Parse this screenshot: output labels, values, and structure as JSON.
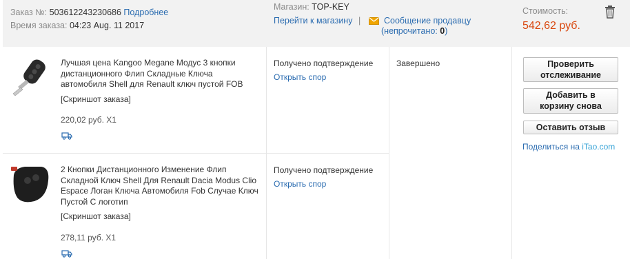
{
  "order": {
    "number_label": "Заказ №:",
    "number": "503612243230686",
    "details_link": "Подробнее",
    "time_label": "Время заказа:",
    "time": "04:23 Aug. 11 2017",
    "store_label": "Магазин:",
    "store_name": "TOP-KEY",
    "go_to_store": "Перейти к магазину",
    "separator": "|",
    "message_link": "Сообщение продавцу",
    "unread_prefix": "(непрочитано: ",
    "unread_count": "0",
    "unread_suffix": ")",
    "cost_label": "Стоимость:",
    "cost_value": "542,62 руб."
  },
  "items": [
    {
      "title": "Лучшая цена Kangoo Megane Модус 3 кнопки дистанционного Флип Складные Ключа автомобиля Shell для Renault ключ пустой FOB",
      "screenshot_label": "[Скриншот заказа]",
      "price_qty": "220,02 руб. X1",
      "status": "Получено подтверждение",
      "dispute_link": "Открыть спор"
    },
    {
      "title": "2 Кнопки Дистанционного Изменение Флип Складной Ключ Shell Для Renault Dacia Modus Clio Espace Логан Ключа Автомобиля Fob Случае Ключ Пустой С логотип",
      "screenshot_label": "[Скриншот заказа]",
      "price_qty": "278,11 руб. X1",
      "status": "Получено подтверждение",
      "dispute_link": "Открыть спор"
    }
  ],
  "order_status": "Завершено",
  "actions": {
    "track_line1": "Проверить",
    "track_line2": "отслеживание",
    "add_cart_line1": "Добавить в",
    "add_cart_line2": "корзину снова",
    "review": "Оставить отзыв",
    "share_prefix": "Поделиться на ",
    "share_site": "iTao.com"
  },
  "icons": {
    "trash": "trash-icon",
    "envelope": "envelope-icon",
    "truck": "delivery-truck-icon"
  },
  "colors": {
    "link": "#2b6cb0",
    "price": "#d9480f",
    "envelope": "#f0a500"
  }
}
